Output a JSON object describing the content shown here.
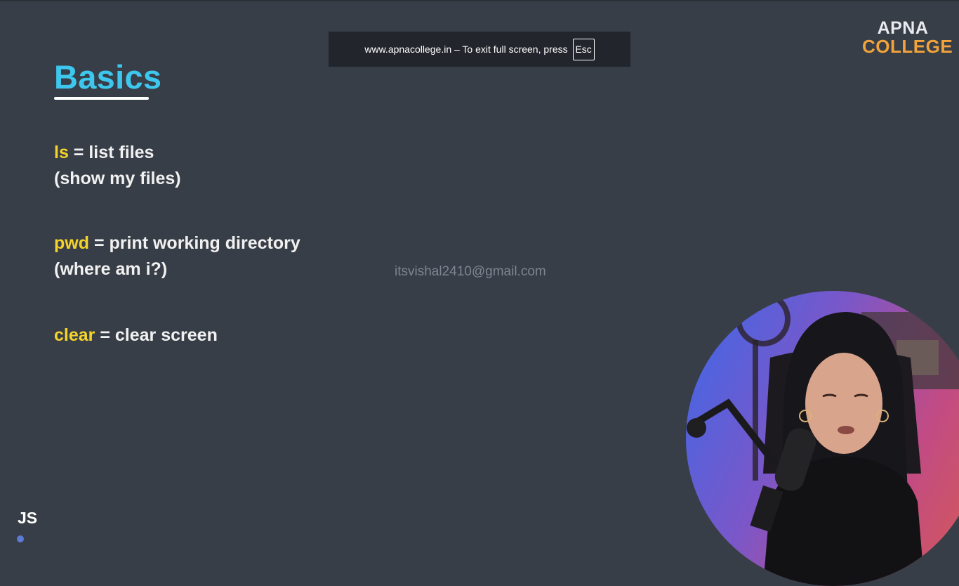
{
  "fullscreen_notice": {
    "message": "www.apnacollege.in – To exit full screen, press",
    "key": "Esc"
  },
  "logo": {
    "line1": "APNA",
    "line2": "COLLEGE"
  },
  "slide": {
    "title": "Basics",
    "items": [
      {
        "command": "ls",
        "separator": " = ",
        "description": "list files",
        "note": "(show my files)"
      },
      {
        "command": "pwd",
        "separator": " = ",
        "description": "print working directory",
        "note": "(where am i?)"
      },
      {
        "command": "clear",
        "separator": " = ",
        "description": "clear screen"
      }
    ],
    "corner_tag": "JS"
  },
  "watermark": "itsvishal2410@gmail.com",
  "colors": {
    "background": "#383e47",
    "title": "#3ec7ee",
    "command": "#f5d42a",
    "logo_accent": "#f2a33a"
  }
}
